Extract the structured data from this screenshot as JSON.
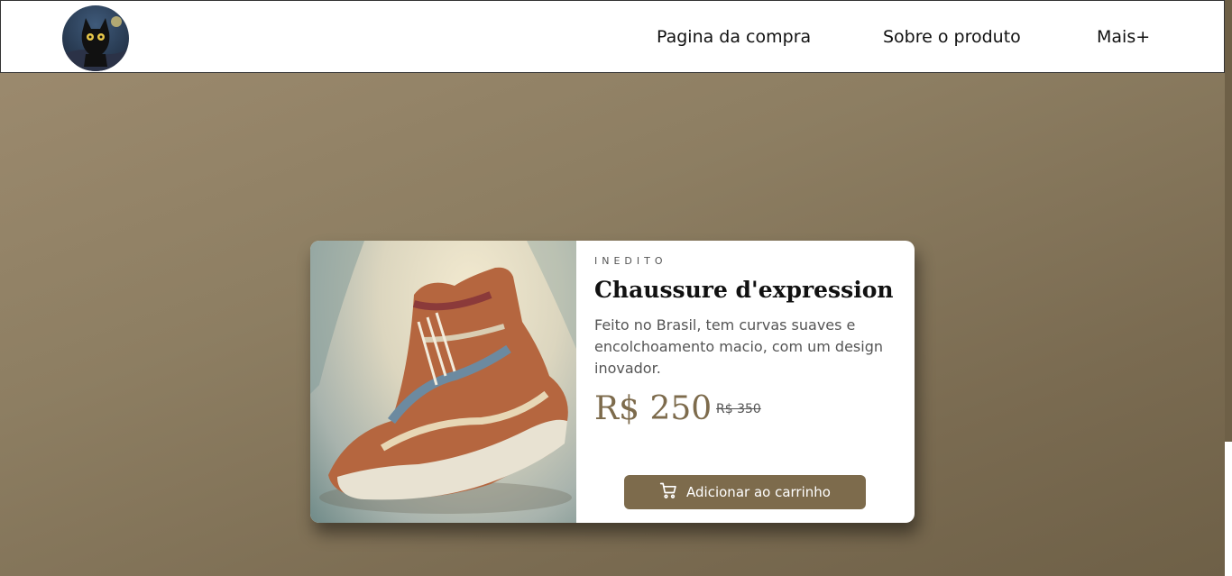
{
  "nav": {
    "logo_icon": "cat-avatar-logo",
    "links": [
      {
        "label": "Pagina da compra"
      },
      {
        "label": "Sobre o produto"
      },
      {
        "label": "Mais+"
      }
    ]
  },
  "product": {
    "category": "INEDITO",
    "title": "Chaussure d'expression",
    "description": "Feito no Brasil, tem curvas suaves e encolchoamento macio, com um design inovador.",
    "price": "R$ 250",
    "old_price": "R$ 350",
    "image_icon": "sneaker-painting",
    "button_label": "Adicionar ao carrinho",
    "button_icon": "cart-icon"
  },
  "colors": {
    "accent": "#7d6b4c",
    "background": "#8d7e62",
    "card": "#ffffff"
  }
}
